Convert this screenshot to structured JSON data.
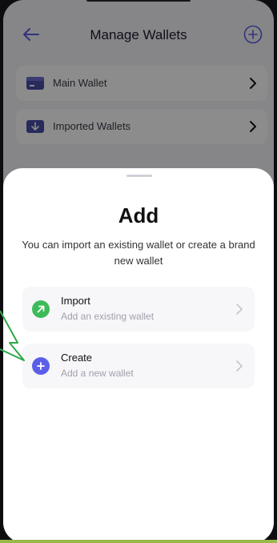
{
  "header": {
    "title": "Manage Wallets",
    "back_icon": "arrow-left-icon",
    "add_icon": "plus-circle-icon",
    "accent_color": "#5a5fe0"
  },
  "wallets": [
    {
      "label": "Main Wallet",
      "icon": "wallet-icon"
    },
    {
      "label": "Imported Wallets",
      "icon": "import-wallet-icon"
    }
  ],
  "sheet": {
    "title": "Add",
    "subtitle": "You can import an existing wallet or create a brand new wallet",
    "options": [
      {
        "title": "Import",
        "subtitle": "Add an existing wallet",
        "icon": "arrow-up-right-icon",
        "color": "#3dbb5a"
      },
      {
        "title": "Create",
        "subtitle": "Add a new wallet",
        "icon": "plus-icon",
        "color": "#5b5fe8"
      }
    ]
  }
}
